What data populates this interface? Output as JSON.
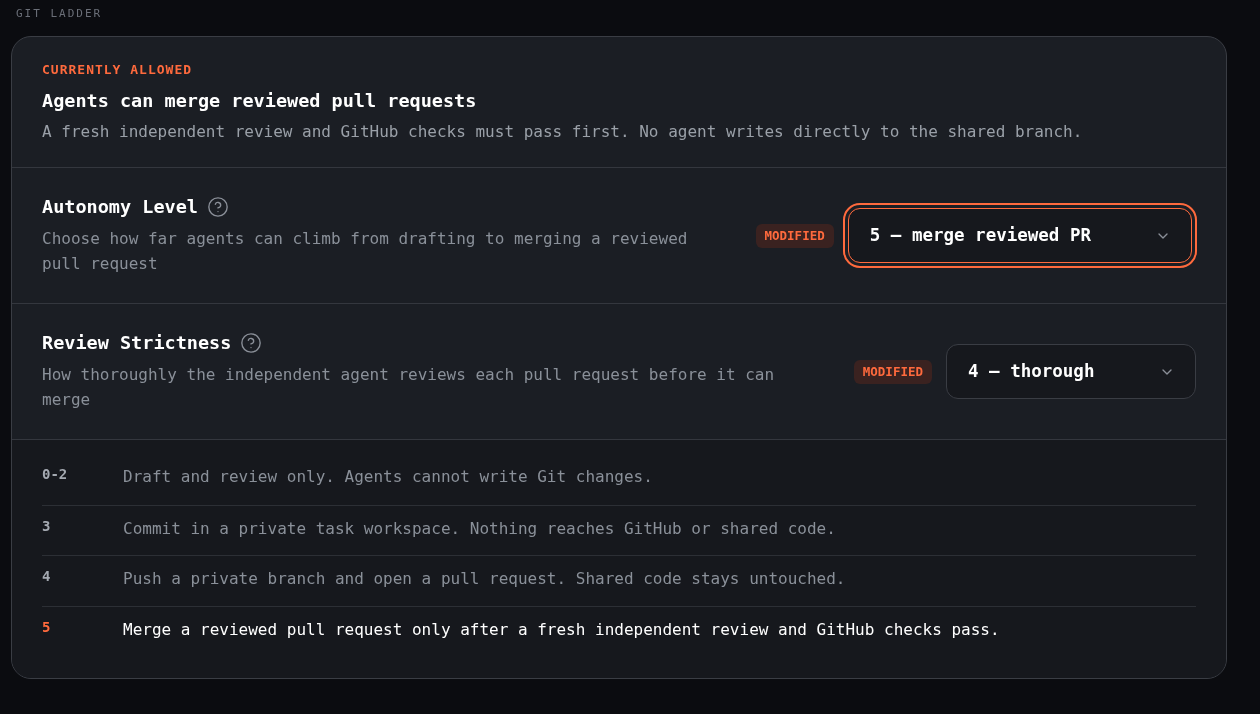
{
  "section_heading": "GIT LADDER",
  "summary": {
    "eyebrow": "CURRENTLY ALLOWED",
    "title": "Agents can merge reviewed pull requests",
    "description": "A fresh independent review and GitHub checks must pass first. No agent writes directly to the shared branch."
  },
  "settings": [
    {
      "label": "Autonomy Level",
      "description": "Choose how far agents can climb from drafting to merging a reviewed pull request",
      "badge": "MODIFIED",
      "value": "5 — merge reviewed PR",
      "focused": true
    },
    {
      "label": "Review Strictness",
      "description": "How thoroughly the independent agent reviews each pull request before it can merge",
      "badge": "MODIFIED",
      "value": "4 — thorough",
      "focused": false
    }
  ],
  "ladder": [
    {
      "level": "0-2",
      "text": "Draft and review only. Agents cannot write Git changes.",
      "selected": false
    },
    {
      "level": "3",
      "text": "Commit in a private task workspace. Nothing reaches GitHub or shared code.",
      "selected": false
    },
    {
      "level": "4",
      "text": "Push a private branch and open a pull request. Shared code stays untouched.",
      "selected": false
    },
    {
      "level": "5",
      "text": "Merge a reviewed pull request only after a fresh independent review and GitHub checks pass.",
      "selected": true
    }
  ]
}
